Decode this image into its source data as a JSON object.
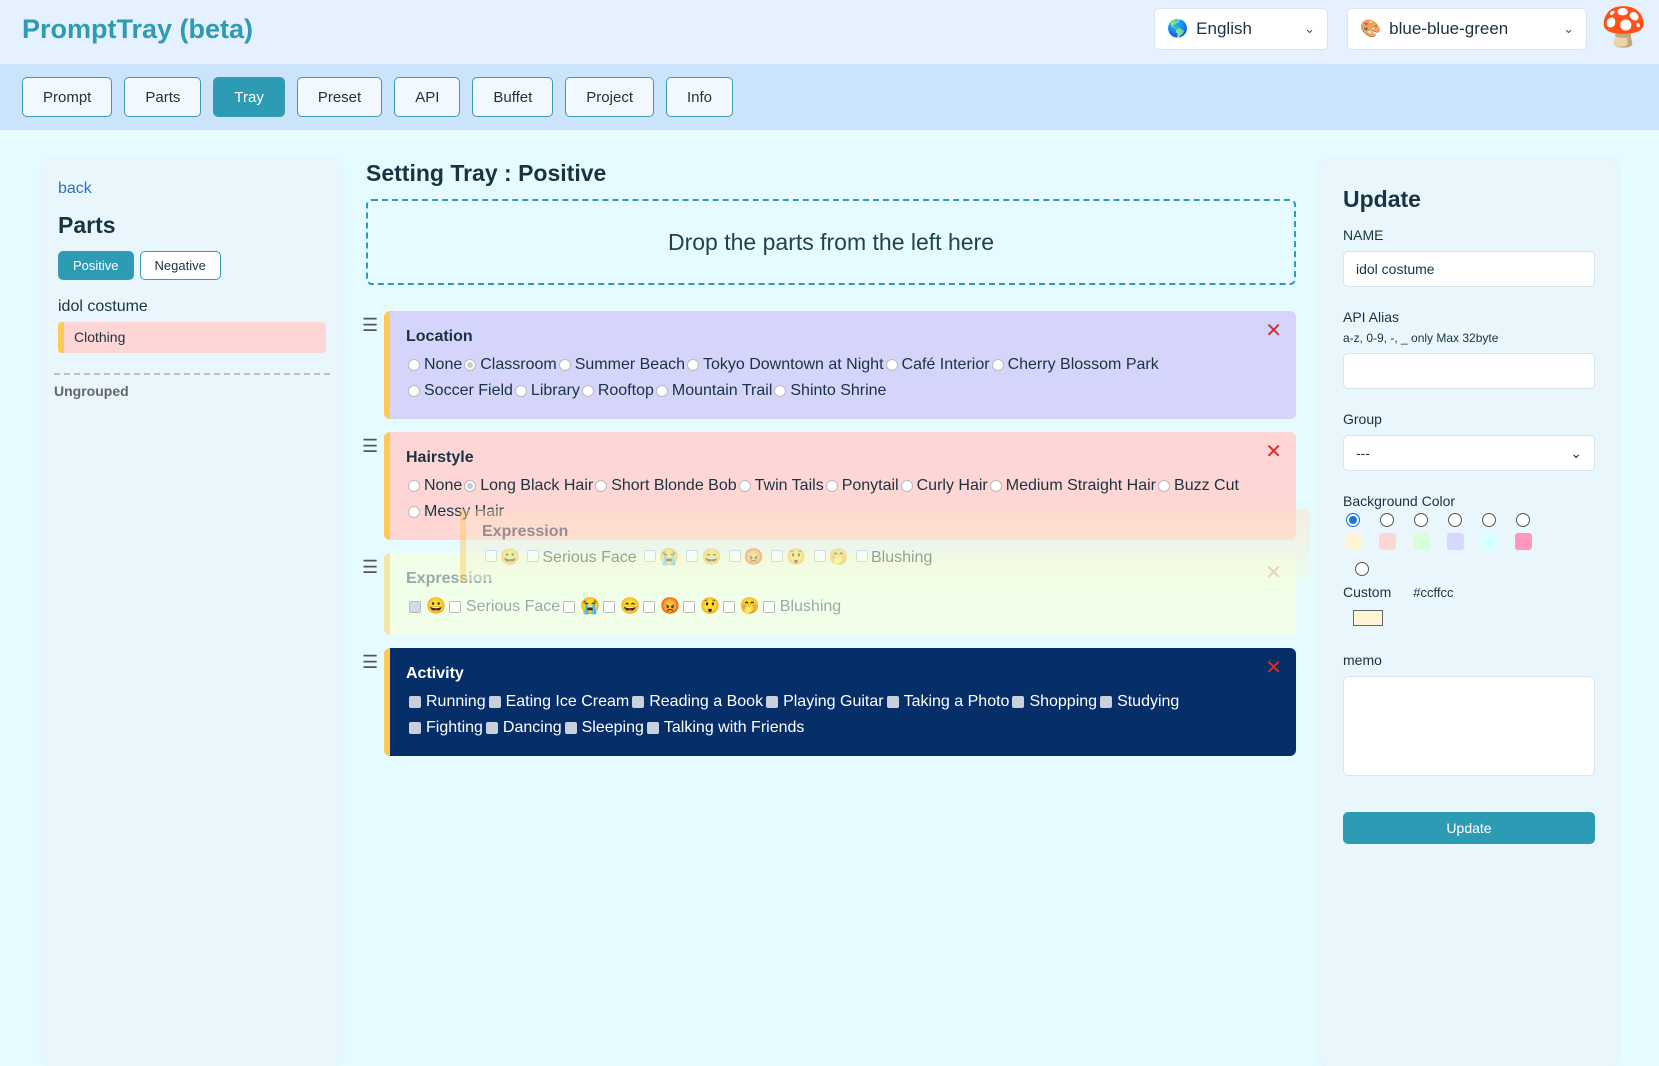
{
  "app": {
    "title": "PromptTray (beta)"
  },
  "header": {
    "language": "English",
    "language_icon": "globe-icon",
    "theme": "blue-blue-green",
    "theme_icon": "palette-icon",
    "avatar_icon": "mushroom-icon"
  },
  "nav": {
    "tabs": [
      {
        "label": "Prompt"
      },
      {
        "label": "Parts"
      },
      {
        "label": "Tray",
        "active": true
      },
      {
        "label": "Preset"
      },
      {
        "label": "API"
      },
      {
        "label": "Buffet"
      },
      {
        "label": "Project"
      },
      {
        "label": "Info"
      }
    ]
  },
  "left": {
    "back": "back",
    "title": "Parts",
    "positive": "Positive",
    "negative": "Negative",
    "group_name": "idol costume",
    "items": [
      "Clothing"
    ],
    "ungrouped": "Ungrouped"
  },
  "center": {
    "title": "Setting Tray : Positive",
    "drop_hint": "Drop the parts from the left here",
    "cards": [
      {
        "name": "Location",
        "type": "radio",
        "bg": "#d5d5fb",
        "options": [
          "None",
          "Classroom",
          "Summer Beach",
          "Tokyo Downtown at Night",
          "Café Interior",
          "Cherry Blossom Park",
          "Soccer Field",
          "Library",
          "Rooftop",
          "Mountain Trail",
          "Shinto Shrine"
        ],
        "selected": "Classroom"
      },
      {
        "name": "Hairstyle",
        "type": "radio",
        "bg": "#ffd6d6",
        "options": [
          "None",
          "Long Black Hair",
          "Short Blonde Bob",
          "Twin Tails",
          "Ponytail",
          "Curly Hair",
          "Medium Straight Hair",
          "Buzz Cut",
          "Messy Hair"
        ],
        "selected": "Long Black Hair"
      },
      {
        "name": "Expression",
        "type": "checkbox",
        "bg": "#f2ffe8",
        "faded": true,
        "options": [
          "😀",
          "Serious Face",
          "😭",
          "😄",
          "😡",
          "😲",
          "🤭",
          "Blushing"
        ],
        "checked": [
          "😀"
        ]
      },
      {
        "name": "Activity",
        "type": "checkbox",
        "bg": "#062f6a",
        "dark": true,
        "options": [
          "Running",
          "Eating Ice Cream",
          "Reading a Book",
          "Playing Guitar",
          "Taking a Photo",
          "Shopping",
          "Studying",
          "Fighting",
          "Dancing",
          "Sleeping",
          "Talking with Friends"
        ],
        "checked": []
      }
    ],
    "ghost": {
      "name": "Expression",
      "options": [
        "😀",
        "Serious Face",
        "😭",
        "😄",
        "😡",
        "😲",
        "🤭",
        "Blushing"
      ]
    }
  },
  "right": {
    "title": "Update",
    "name_label": "NAME",
    "name_value": "idol costume",
    "alias_label": "API Alias",
    "alias_hint": "a-z, 0-9, -, _ only Max 32byte",
    "alias_value": "",
    "group_label": "Group",
    "group_value": "---",
    "bg_label": "Background Color",
    "colors": [
      "#fff5d6",
      "#ffd6d6",
      "#d6ffd6",
      "#d6d6ff",
      "#d6ffff",
      "#ff99bb"
    ],
    "selected_color_index": 0,
    "custom_label": "Custom",
    "custom_value": "#ccffcc",
    "custom_swatch": "#fff5d6",
    "memo_label": "memo",
    "memo_value": "",
    "update_button": "Update"
  }
}
